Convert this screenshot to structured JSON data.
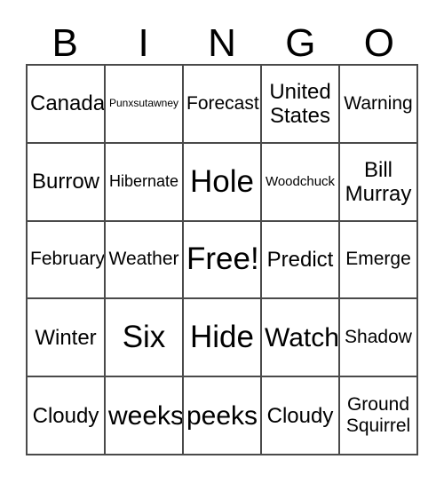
{
  "card": {
    "title": "BINGO",
    "header_letters": [
      "B",
      "I",
      "N",
      "G",
      "O"
    ],
    "grid_color": "#4a4a4a",
    "background_color": "#ffffff",
    "text_color": "#000000",
    "rows": 5,
    "columns": 5,
    "free_space": {
      "row": 3,
      "column": 3,
      "label": "Free!"
    }
  },
  "cells": [
    {
      "text": "Canada",
      "size": "l"
    },
    {
      "text": "Punxsutawney",
      "size": "xxs"
    },
    {
      "text": "Forecast",
      "size": "m"
    },
    {
      "text": "United\nStates",
      "size": "l"
    },
    {
      "text": "Warning",
      "size": "m"
    },
    {
      "text": "Burrow",
      "size": "l"
    },
    {
      "text": "Hibernate",
      "size": "s"
    },
    {
      "text": "Hole",
      "size": "xxl"
    },
    {
      "text": "Woodchuck",
      "size": "xs"
    },
    {
      "text": "Bill\nMurray",
      "size": "l"
    },
    {
      "text": "February",
      "size": "m"
    },
    {
      "text": "Weather",
      "size": "m"
    },
    {
      "text": "Free!",
      "size": "xxl"
    },
    {
      "text": "Predict",
      "size": "l"
    },
    {
      "text": "Emerge",
      "size": "m"
    },
    {
      "text": "Winter",
      "size": "l"
    },
    {
      "text": "Six",
      "size": "xxl"
    },
    {
      "text": "Hide",
      "size": "xxl"
    },
    {
      "text": "Watch",
      "size": "xl"
    },
    {
      "text": "Shadow",
      "size": "m"
    },
    {
      "text": "Cloudy",
      "size": "l"
    },
    {
      "text": "weeks",
      "size": "xl"
    },
    {
      "text": "peeks",
      "size": "xl"
    },
    {
      "text": "Cloudy",
      "size": "l"
    },
    {
      "text": "Ground\nSquirrel",
      "size": "m"
    }
  ]
}
